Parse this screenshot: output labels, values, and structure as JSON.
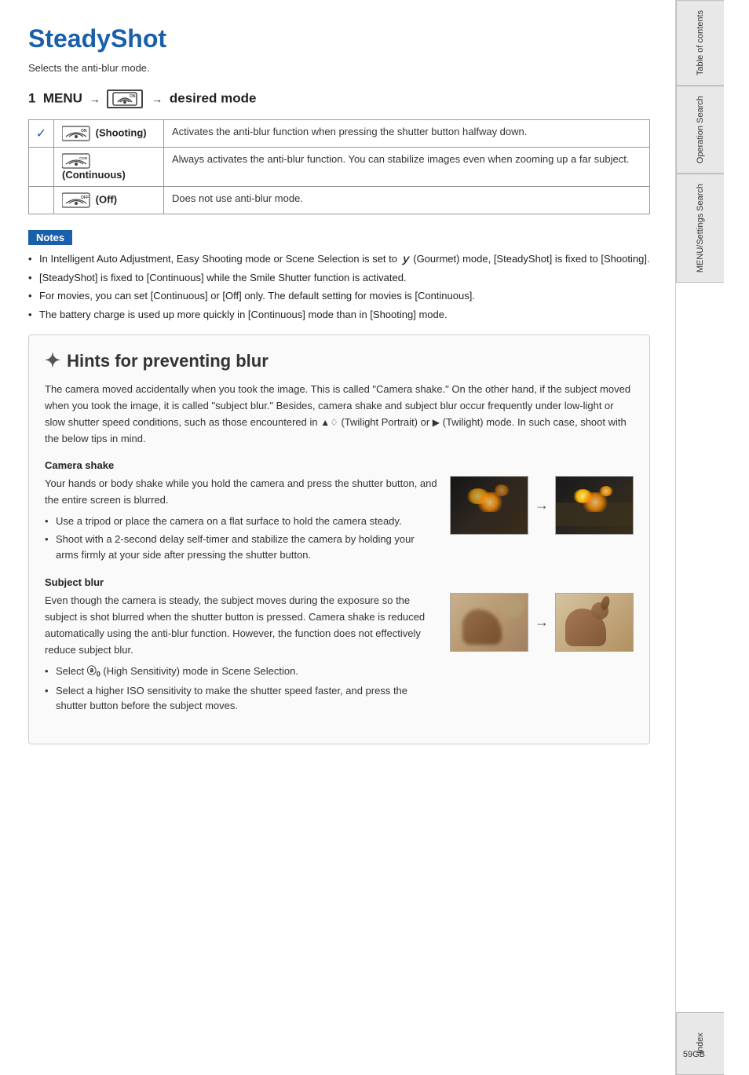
{
  "page": {
    "title": "SteadyShot",
    "subtitle": "Selects the anti-blur mode.",
    "page_number": "59",
    "page_suffix": "GB",
    "menu_path": "1  MENU → ",
    "menu_middle": "(SteadyShot) → desired mode"
  },
  "table": {
    "rows": [
      {
        "has_check": true,
        "mode_label": "(Shooting)",
        "description": "Activates the anti-blur function when pressing the shutter button halfway down."
      },
      {
        "has_check": false,
        "mode_label": "(Continuous)",
        "description": "Always activates the anti-blur function. You can stabilize images even when zooming up a far subject."
      },
      {
        "has_check": false,
        "mode_label": "(Off)",
        "description": "Does not use anti-blur mode."
      }
    ]
  },
  "notes": {
    "label": "Notes",
    "items": [
      "In Intelligent Auto Adjustment, Easy Shooting mode or Scene Selection is set to ｙ (Gourmet) mode, [SteadyShot] is fixed to [Shooting].",
      "[SteadyShot] is fixed to [Continuous] while the Smile Shutter function is activated.",
      "For movies, you can set [Continuous] or [Off] only. The default setting for movies is [Continuous].",
      "The battery charge is used up more quickly in [Continuous] mode than in [Shooting] mode."
    ]
  },
  "hints": {
    "title": "Hints for preventing blur",
    "body": "The camera moved accidentally when you took the image. This is called \"Camera shake.\" On the other hand, if the subject moved when you took the image, it is called \"subject blur.\" Besides, camera shake and subject blur occur frequently under low-light or slow shutter speed conditions, such as those encountered in ▲♧ (Twilight Portrait) or ◖ (Twilight) mode. In such case, shoot with the below tips in mind.",
    "camera_shake": {
      "title": "Camera shake",
      "intro": "Your hands or body shake while you hold the camera and press the shutter button, and the entire screen is blurred.",
      "tips": [
        "Use a tripod or place the camera on a flat surface to hold the camera steady.",
        "Shoot with a 2-second delay self-timer and stabilize the camera by holding your arms firmly at your side after pressing the shutter button."
      ]
    },
    "subject_blur": {
      "title": "Subject blur",
      "intro": "Even though the camera is steady, the subject moves during the exposure so the subject is shot blurred when the shutter button is pressed. Camera shake is reduced automatically using the anti-blur function. However, the function does not effectively reduce subject blur.",
      "tips": [
        "Select Ⓢ₀ (High Sensitivity) mode in Scene Selection.",
        "Select a higher ISO sensitivity to make the shutter speed faster, and press the shutter button before the subject moves."
      ]
    }
  },
  "sidebar": {
    "tabs": [
      {
        "label": "Table of contents",
        "active": false
      },
      {
        "label": "Operation Search",
        "active": false
      },
      {
        "label": "MENU/Settings Search",
        "active": false
      },
      {
        "label": "Index",
        "active": false
      }
    ]
  }
}
